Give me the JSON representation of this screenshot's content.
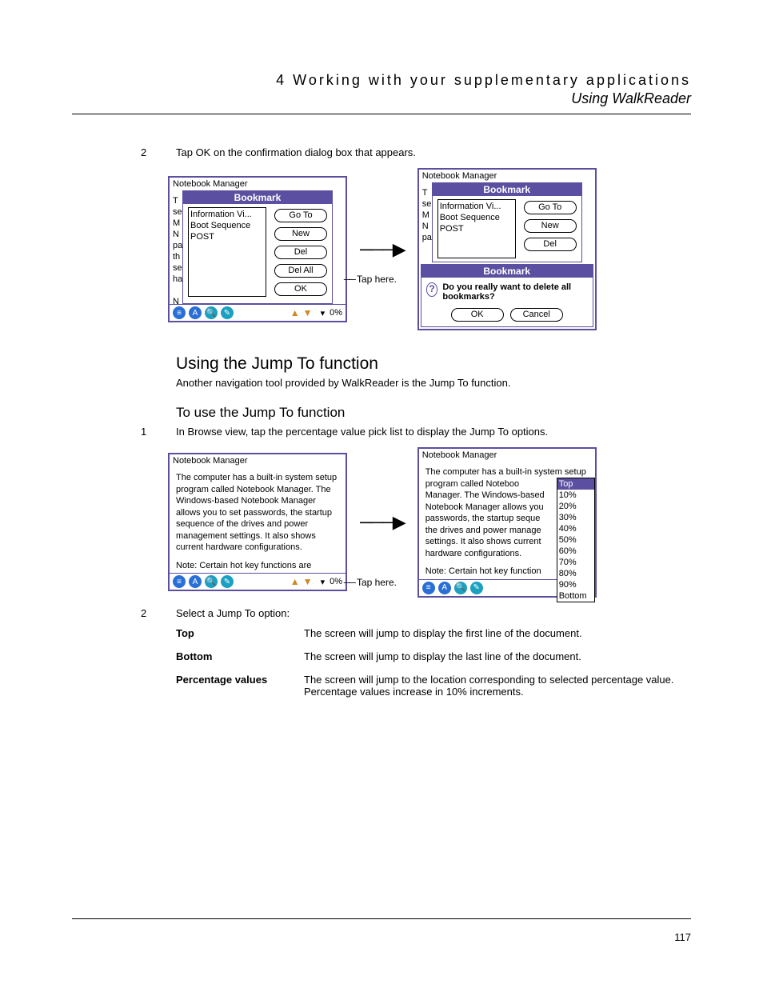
{
  "header": {
    "chapter": "4 Working with your supplementary applications",
    "section": "Using WalkReader"
  },
  "steps": {
    "s2a": "Tap OK on the confirmation dialog box that appears.",
    "s1b": "In Browse view, tap the percentage value pick list to display the Jump To options.",
    "s2b": "Select a Jump To option:"
  },
  "headings": {
    "jump": "Using the Jump To function",
    "jump_intro": "Another navigation tool provided by WalkReader is the Jump To function.",
    "jump_howto": "To use the Jump To function"
  },
  "captions": {
    "tap_here": "Tap here."
  },
  "pda": {
    "title": "Notebook Manager",
    "bookmark_bar": "Bookmark",
    "list": {
      "i0": "Information Vi...",
      "i1": "Boot Sequence",
      "i2": "POST"
    },
    "btns": {
      "goto": "Go To",
      "new": "New",
      "del": "Del",
      "delall": "Del All",
      "ok": "OK",
      "cancel": "Cancel"
    },
    "margin": {
      "l0": "T",
      "l1": "se",
      "l2": "M",
      "l3": "N",
      "l4": "pa",
      "l5": "th",
      "l6": "se",
      "l7": "ha",
      "l8": "N"
    },
    "pct": "0%",
    "confirm": "Do you really want to delete all bookmarks?",
    "doc_text1": "The computer has a built-in system setup program called Notebook Manager. The Windows-based Notebook Manager allows you to set passwords, the startup sequence of the drives and power management settings. It also shows current hardware configurations.",
    "doc_text2": "Note: Certain hot key functions are",
    "doc_text1b": "The computer has a built-in system setup program called Noteboo",
    "lines_b": {
      "l1": "Manager. The Windows-based",
      "l2": "Notebook Manager allows you",
      "l3": "passwords, the startup seque",
      "l4": "the drives and power manage",
      "l5": "settings. It also shows current",
      "l6": "hardware configurations.",
      "l7": "Note: Certain hot key function"
    },
    "jump": {
      "top": "Top",
      "p10": "10%",
      "p20": "20%",
      "p30": "30%",
      "p40": "40%",
      "p50": "50%",
      "p60": "60%",
      "p70": "70%",
      "p80": "80%",
      "p90": "90%",
      "bottom": "Bottom"
    }
  },
  "options": {
    "top": {
      "term": "Top",
      "desc": "The screen will jump to display the first line of the document."
    },
    "bottom": {
      "term": "Bottom",
      "desc": "The screen will jump to display the last line of the document."
    },
    "pct": {
      "term": "Percentage values",
      "desc": "The screen will jump to the location corresponding to selected percentage value. Percentage values increase in 10% increments."
    }
  },
  "page_number": "117"
}
